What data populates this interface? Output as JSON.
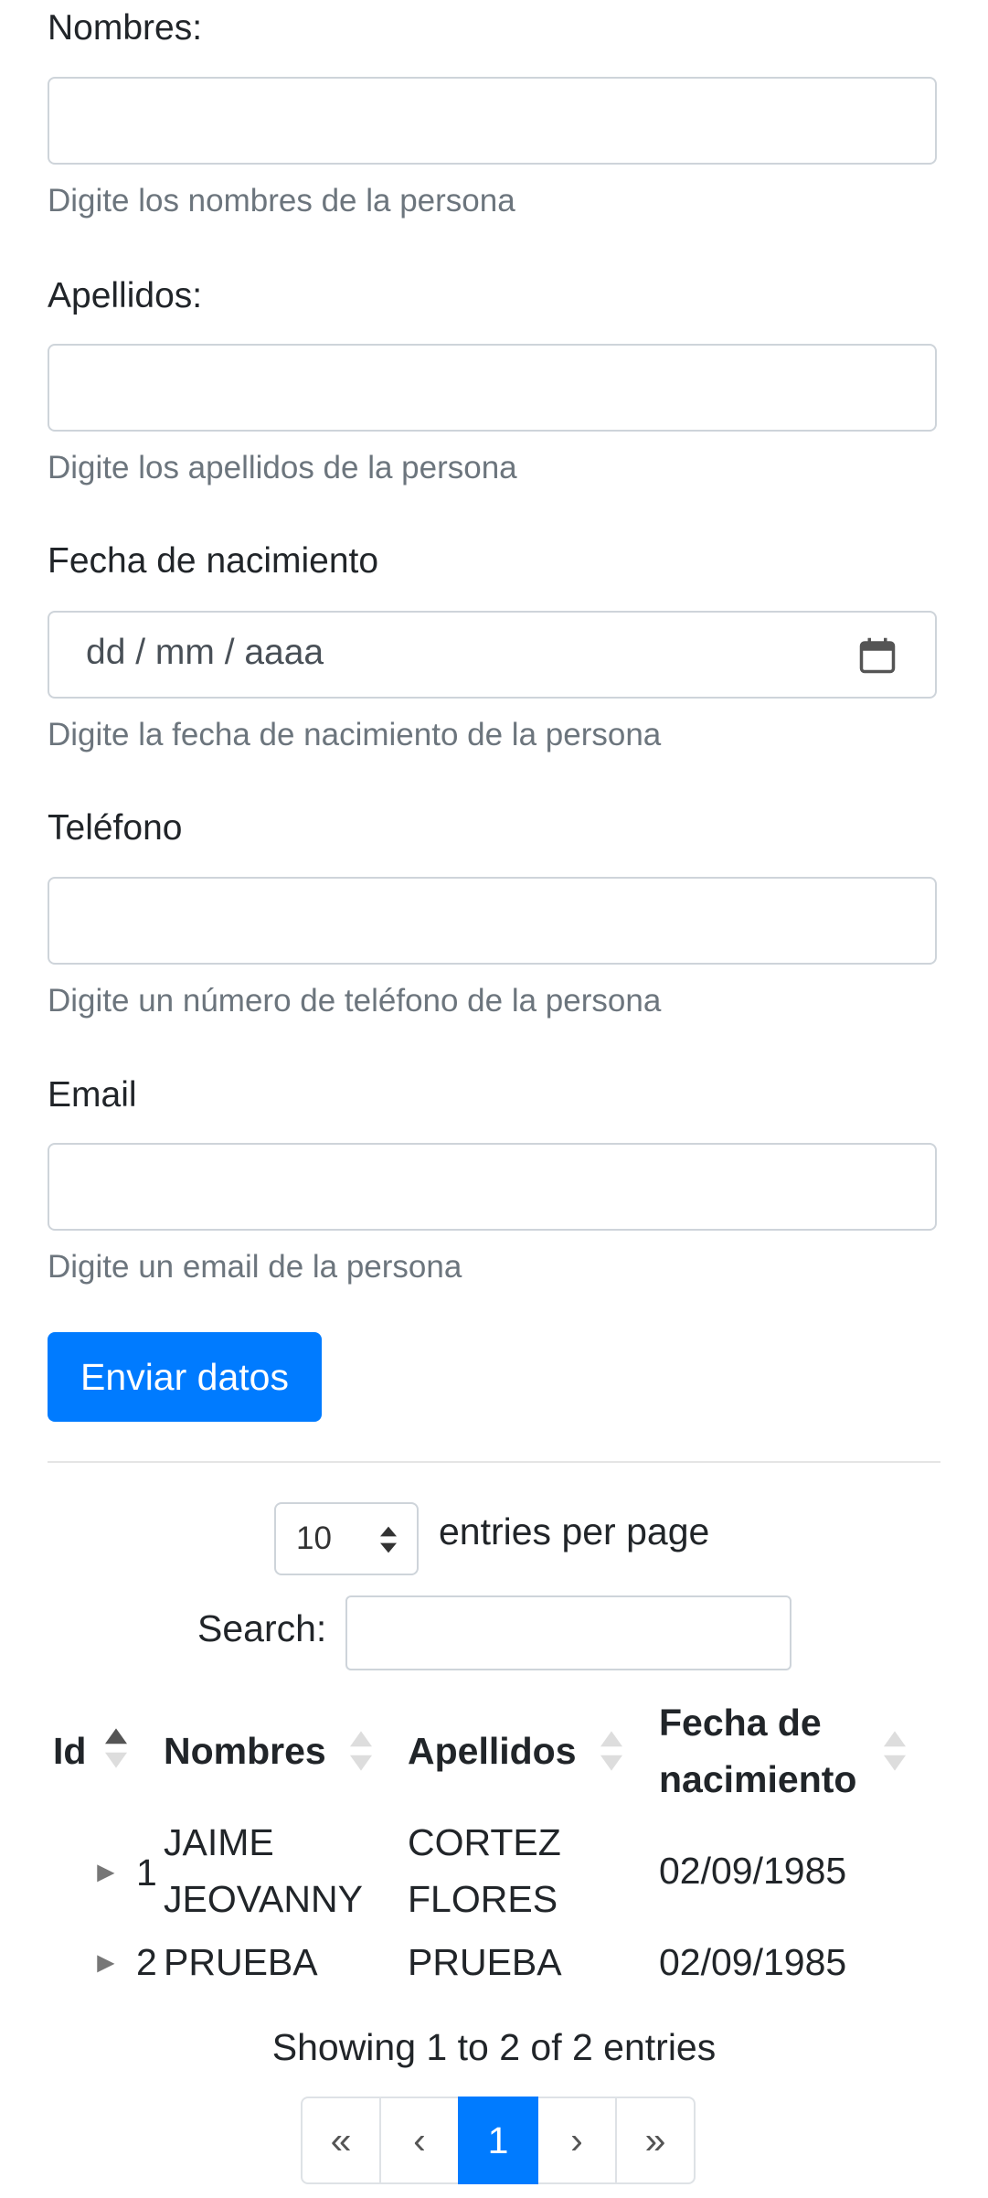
{
  "form": {
    "fields": [
      {
        "label": "Nombres:",
        "help": "Digite los nombres de la persona",
        "value": ""
      },
      {
        "label": "Apellidos:",
        "help": "Digite los apellidos de la persona",
        "value": ""
      },
      {
        "label": "Fecha de nacimiento",
        "help": "Digite la fecha de nacimiento de la persona",
        "placeholder": "dd / mm / aaaa"
      },
      {
        "label": "Teléfono",
        "help": "Digite un número de teléfono de la persona",
        "value": ""
      },
      {
        "label": "Email",
        "help": "Digite un email de la persona",
        "value": ""
      }
    ],
    "submit_label": "Enviar datos"
  },
  "table_controls": {
    "page_size": "10",
    "entries_per_page_label": "entries per page",
    "search_label": "Search:",
    "search_value": ""
  },
  "table": {
    "headers": [
      "Id",
      "Nombres",
      "Apellidos",
      "Fecha de nacimiento"
    ],
    "header_lines": {
      "fecha_1": "Fecha de",
      "fecha_2": "nacimiento"
    },
    "rows": [
      {
        "id": "1",
        "nombres_1": "JAIME",
        "nombres_2": "JEOVANNY",
        "apellidos_1": "CORTEZ",
        "apellidos_2": "FLORES",
        "fecha": "02/09/1985",
        "expand_icon": "►"
      },
      {
        "id": "2",
        "nombres_1": "PRUEBA",
        "apellidos_1": "PRUEBA",
        "fecha": "02/09/1985",
        "expand_icon": "►"
      }
    ],
    "showing": "Showing 1 to 2 of 2 entries"
  },
  "pagination": [
    "«",
    "‹",
    "1",
    "›",
    "»"
  ],
  "colors": {
    "accent": "#007bff",
    "border": "#ced4da",
    "muted": "#6c757d"
  }
}
